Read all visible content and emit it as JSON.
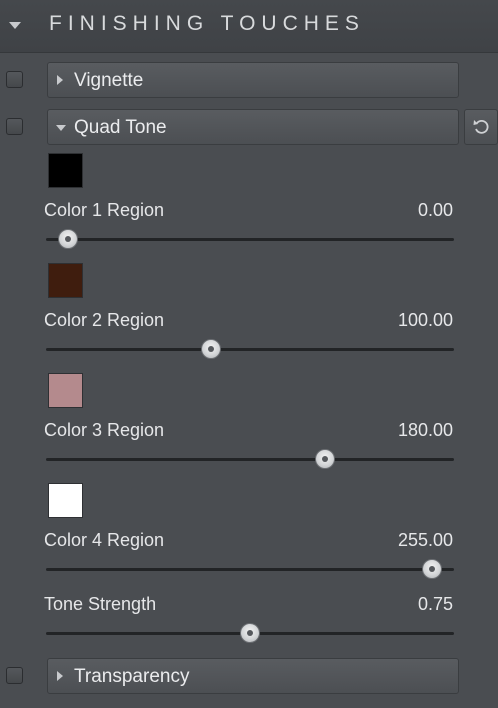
{
  "header": {
    "title": "FINISHING TOUCHES"
  },
  "sections": {
    "vignette": {
      "label": "Vignette",
      "expanded": false,
      "enabled": false
    },
    "quad_tone": {
      "label": "Quad Tone",
      "expanded": true,
      "enabled": false
    },
    "transparency": {
      "label": "Transparency",
      "expanded": false,
      "enabled": false
    }
  },
  "quad_tone": {
    "reset_icon": "reset-icon",
    "colors": [
      {
        "swatch": "#000000",
        "label": "Color 1 Region",
        "value": "0.00",
        "numeric": 0,
        "min": 0,
        "max": 255
      },
      {
        "swatch": "#3f1d0e",
        "label": "Color 2 Region",
        "value": "100.00",
        "numeric": 100,
        "min": 0,
        "max": 255
      },
      {
        "swatch": "#b48a8d",
        "label": "Color 3 Region",
        "value": "180.00",
        "numeric": 180,
        "min": 0,
        "max": 255
      },
      {
        "swatch": "#ffffff",
        "label": "Color 4 Region",
        "value": "255.00",
        "numeric": 255,
        "min": 0,
        "max": 255
      }
    ],
    "strength": {
      "label": "Tone Strength",
      "value": "0.75",
      "numeric": 0.75,
      "min": 0,
      "max": 1.5
    }
  }
}
